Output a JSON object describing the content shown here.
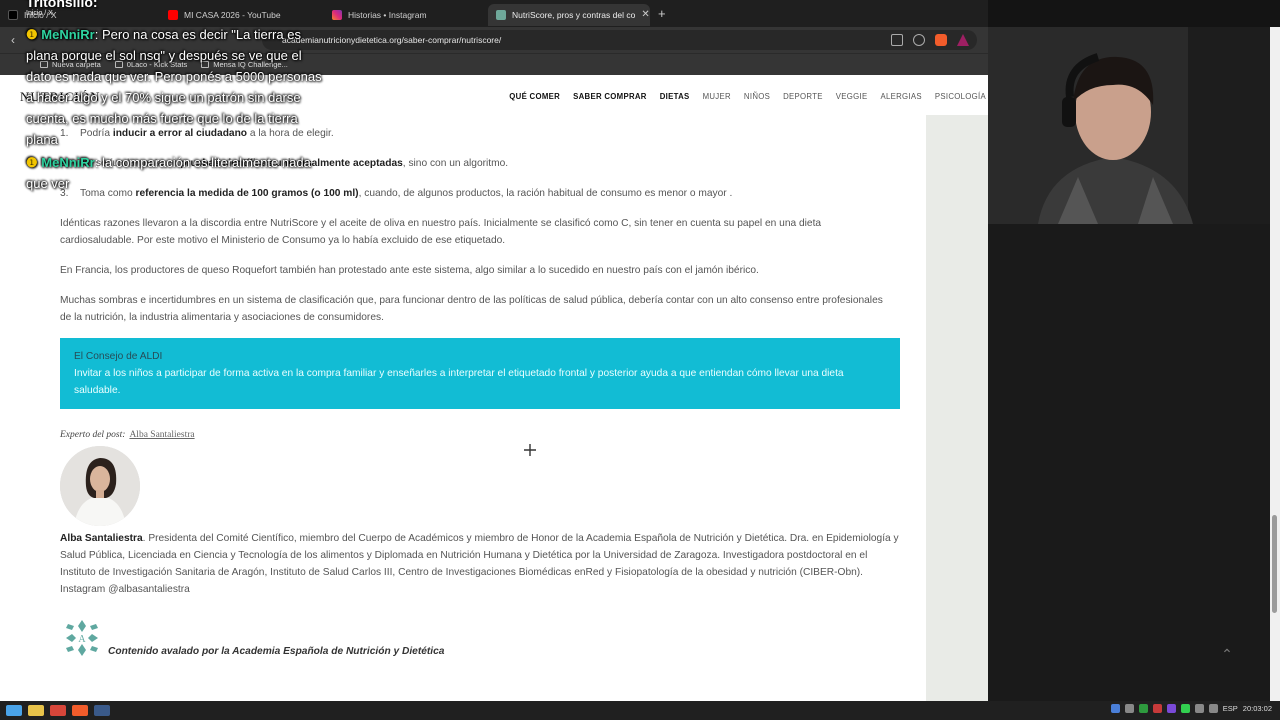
{
  "browser": {
    "tabs": [
      {
        "label": "Inicio / X",
        "color": "#000000"
      },
      {
        "label": "MI CASA 2026 - YouTube",
        "color": "#ff0000"
      },
      {
        "label": "Historias • Instagram",
        "color": "#d6249f"
      },
      {
        "label": "NutriScore, pros y contras del co",
        "color": "#6fa89a"
      }
    ],
    "url": "academianutricionydietetica.org/saber-comprar/nutriscore/",
    "bookmarks": [
      "Nueva carpeta",
      "0Laco - Kick Stats",
      "Mensa IQ Challenge..."
    ]
  },
  "site": {
    "logo": "NUTRICIÓN",
    "nav": [
      "QUÉ COMER",
      "SABER COMPRAR",
      "DIETAS",
      "MUJER",
      "NIÑOS",
      "DEPORTE",
      "VEGGIE",
      "ALERGIAS",
      "PSICOLOGÍA"
    ]
  },
  "article": {
    "list": [
      {
        "num": "1.",
        "pre": "Podría ",
        "bold": "inducir a error al ciudadano",
        "post": " a la hora de elegir."
      },
      {
        "num": "2.",
        "pre": "No se fundamenta en ",
        "bold": "pruebas científicas universalmente aceptadas",
        "post": ", sino con un algoritmo."
      },
      {
        "num": "3.",
        "pre": "Toma como ",
        "bold": "referencia la medida de 100 gramos (o 100 ml)",
        "post": ", cuando, de algunos productos, la ración habitual de consumo es menor o mayor ."
      }
    ],
    "paragraphs": [
      "Idénticas razones llevaron a la discordia entre NutriScore y el aceite de oliva en nuestro país. Inicialmente se clasificó como C, sin tener en cuenta su papel en una dieta cardiosaludable. Por este motivo el Ministerio de Consumo ya lo había excluido de ese etiquetado.",
      "En Francia, los productores de queso Roquefort también han protestado ante este sistema, algo similar a lo sucedido en nuestro país con el jamón ibérico.",
      "Muchas sombras e incertidumbres en un sistema de clasificación que, para funcionar dentro de las políticas de salud pública, debería contar con un alto consenso entre profesionales de la nutrición, la industria alimentaria y asociaciones de consumidores."
    ],
    "advice": {
      "title": "El Consejo de ALDI",
      "text": "Invitar a los niños a participar de forma activa en la compra familiar y enseñarles a interpretar el etiquetado frontal y posterior ayuda a que entiendan cómo llevar una dieta saludable."
    },
    "expert_label": "Experto del post:",
    "expert_name": "Alba Santaliestra",
    "bio_name": "Alba Santaliestra",
    "bio_text": ". Presidenta del Comité Científico, miembro del Cuerpo de Académicos y miembro de Honor de la Academia Española de Nutrición y Dietética. Dra. en Epidemiología y Salud Pública, Licenciada en Ciencia y Tecnología de los alimentos y Diplomada en Nutrición Humana y Dietética por la Universidad de Zaragoza. Investigadora postdoctoral en el Instituto de Investigación Sanitaria de Aragón, Instituto de Salud Carlos III, Centro de Investigaciones Biomédicas enRed y Fisiopatología de la obesidad y nutrición (CIBER-Obn). Instagram @albasantaliestra",
    "academy_text": "Contenido avalado por la Academia Española de Nutrición y Dietética"
  },
  "overlay": {
    "streamer": "Tritonsillo:",
    "streamer_sub": "Inicio / X",
    "messages": [
      {
        "user": "MeNniRr",
        "text": ": Pero na cosa es decir \"La tierra es plana porque el sol nsq\" y después se ve que el dato es nada que ver. Pero ponés a 5000 personas a hacer algo y el 70% sigue un patrón sin darse cuenta, es mucho más fuerte que lo de la tierra plana"
      },
      {
        "user": "MeNniRr",
        "text": ": la comparación es literalmente nada que ver"
      }
    ]
  },
  "taskbar": {
    "lang": "ESP",
    "time": "20:03:02"
  }
}
